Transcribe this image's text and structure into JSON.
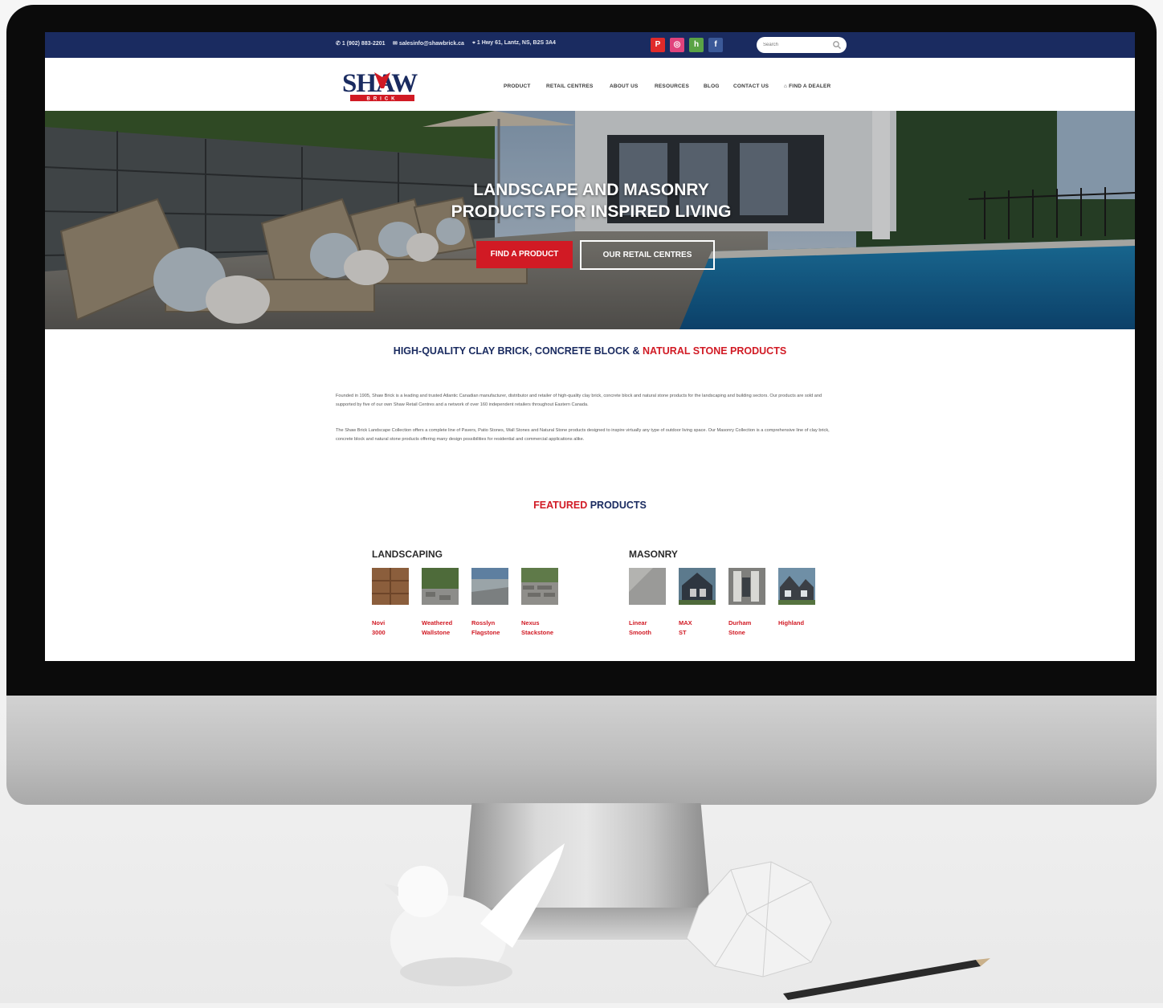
{
  "topbar": {
    "phone": "1 (902) 883-2201",
    "email": "salesinfo@shawbrick.ca",
    "address": "1 Hwy 61, Lantz, NS, B2S 3A4",
    "socials": [
      {
        "icon": "pinterest-icon",
        "glyph": "P",
        "color": "#e02a2a"
      },
      {
        "icon": "instagram-icon",
        "glyph": "◎",
        "color": "#e0437c"
      },
      {
        "icon": "houzz-icon",
        "glyph": "h",
        "color": "#5aa345"
      },
      {
        "icon": "facebook-icon",
        "glyph": "f",
        "color": "#3b5998"
      }
    ],
    "search_placeholder": "Search"
  },
  "logo": {
    "text": "SHAW",
    "sub": "BRICK"
  },
  "nav": [
    "PRODUCT",
    "RETAIL CENTRES",
    "ABOUT US",
    "RESOURCES",
    "BLOG",
    "CONTACT US",
    "FIND A DEALER"
  ],
  "hero": {
    "title_line1": "LANDSCAPE AND MASONRY",
    "title_line2": "PRODUCTS FOR INSPIRED LIVING",
    "btn_primary": "FIND A PRODUCT",
    "btn_secondary": "OUR RETAIL CENTRES"
  },
  "intro": {
    "headline_blue": "HIGH-QUALITY CLAY BRICK, CONCRETE BLOCK & ",
    "headline_red": "NATURAL STONE PRODUCTS",
    "para1": "Founded in 1905, Shaw Brick is a leading and trusted Atlantic Canadian manufacturer, distributor and retailer of high-quality clay brick, concrete block and natural stone products for the landscaping and building sectors. Our products are sold and supported by five of our own Shaw Retail Centres and a network of over 160 independent retailers throughout Eastern Canada.",
    "para2": "The Shaw Brick Landscape Collection offers a complete line of Pavers, Patio Stones, Wall Stones and Natural Stone products designed to inspire virtually any type of outdoor living space. Our Masonry Collection is a comprehensive line of clay brick, concrete block and natural stone products offering many design possibilities for residential and commercial applications alike."
  },
  "featured": {
    "red": "FEATURED",
    "blue": " PRODUCTS"
  },
  "landscaping": {
    "title": "LANDSCAPING",
    "items": [
      {
        "l1": "Novi",
        "l2": "3000"
      },
      {
        "l1": "Weathered",
        "l2": "Wallstone"
      },
      {
        "l1": "Rosslyn",
        "l2": "Flagstone"
      },
      {
        "l1": "Nexus",
        "l2": "Stackstone"
      }
    ]
  },
  "masonry": {
    "title": "MASONRY",
    "items": [
      {
        "l1": "Linear",
        "l2": "Smooth"
      },
      {
        "l1": "MAX",
        "l2": "ST"
      },
      {
        "l1": "Durham",
        "l2": "Stone"
      },
      {
        "l1": "Highland",
        "l2": ""
      }
    ]
  }
}
